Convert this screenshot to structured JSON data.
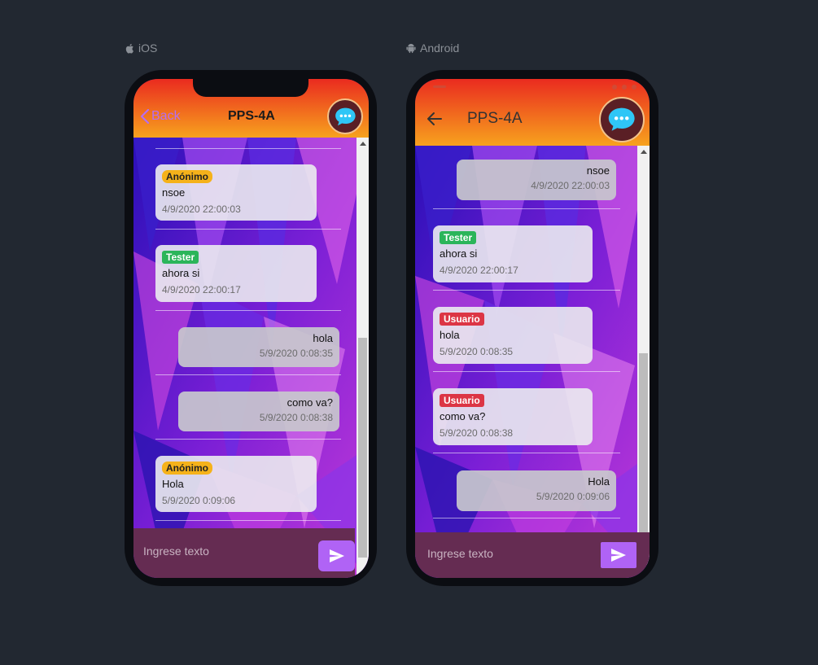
{
  "platforms": {
    "ios": {
      "label": "iOS",
      "back_label": "Back",
      "title": "PPS-4A",
      "input_placeholder": "Ingrese texto",
      "messages": [
        {
          "badge": "Anónimo",
          "text": "nsoe",
          "time": "4/9/2020 22:00:03"
        },
        {
          "badge": "Tester",
          "text": "ahora si",
          "time": "4/9/2020 22:00:17"
        },
        {
          "text": "hola",
          "time": "5/9/2020 0:08:35"
        },
        {
          "text": "como va?",
          "time": "5/9/2020 0:08:38"
        },
        {
          "badge": "Anónimo",
          "text": "Hola",
          "time": "5/9/2020 0:09:06"
        }
      ]
    },
    "android": {
      "label": "Android",
      "title": "PPS-4A",
      "input_placeholder": "Ingrese texto",
      "messages": [
        {
          "text": "nsoe",
          "time": "4/9/2020 22:00:03"
        },
        {
          "badge": "Tester",
          "text": "ahora si",
          "time": "4/9/2020 22:00:17"
        },
        {
          "badge": "Usuario",
          "text": "hola",
          "time": "5/9/2020 0:08:35"
        },
        {
          "badge": "Usuario",
          "text": "como va?",
          "time": "5/9/2020 0:08:38"
        },
        {
          "text": "Hola",
          "time": "5/9/2020 0:09:06"
        }
      ]
    }
  },
  "icons": {
    "apple": "apple-icon",
    "android": "android-icon",
    "back": "chevron-left-icon",
    "arrow_back": "arrow-left-icon",
    "chat_avatar": "chat-bubble-icon",
    "send": "send-icon"
  },
  "colors": {
    "page_bg": "#222831",
    "header_top": "#ea2b1f",
    "header_bottom": "#f7a21e",
    "accent": "#b063f5",
    "composer_bg": "#652c52",
    "badge_anon": "#f5b21a",
    "badge_tester": "#2bb55a",
    "badge_usuario": "#dc3545"
  }
}
